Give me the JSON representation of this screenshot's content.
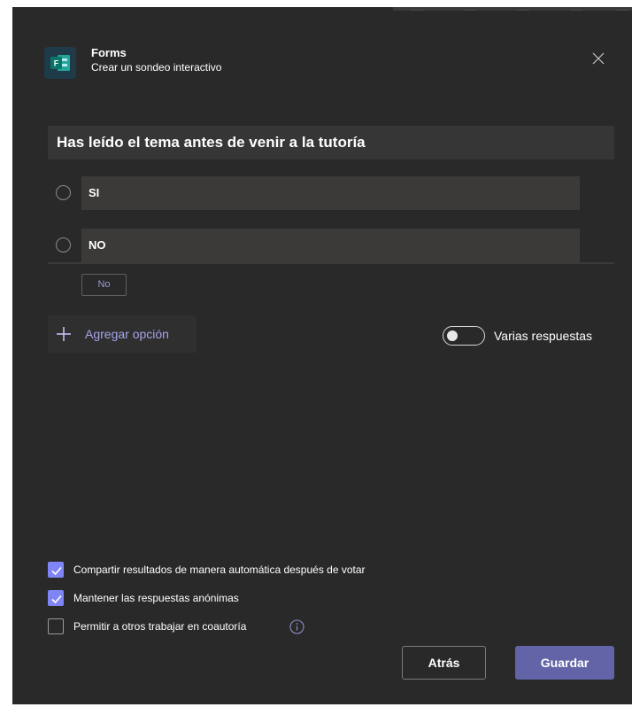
{
  "header": {
    "app_title": "Forms",
    "app_subtitle": "Crear un sondeo interactivo"
  },
  "poll": {
    "question": "Has leído el tema antes de venir a la tutoría",
    "options": [
      {
        "label": "SI"
      },
      {
        "label": "NO"
      }
    ],
    "suggestion_chip": "No",
    "add_option_label": "Agregar opción",
    "multiple_answers_label": "Varias respuestas",
    "multiple_answers_enabled": false
  },
  "settings": [
    {
      "label": "Compartir resultados de manera automática después de votar",
      "checked": true
    },
    {
      "label": "Mantener las respuestas anónimas",
      "checked": true
    },
    {
      "label": "Permitir a otros trabajar en coautoría",
      "checked": false
    }
  ],
  "footer": {
    "back_label": "Atrás",
    "save_label": "Guardar"
  },
  "colors": {
    "dialog_bg": "#292929",
    "accent": "#6264a7",
    "checkbox_checked": "#7f85f5",
    "link_text": "#a6a4ea",
    "forms_brand": "#077568"
  }
}
